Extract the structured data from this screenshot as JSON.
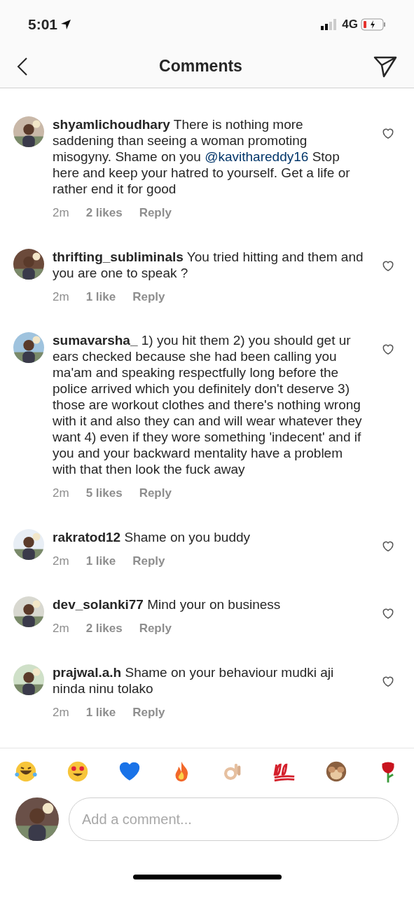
{
  "status_bar": {
    "time": "5:01",
    "network": "4G"
  },
  "header": {
    "title": "Comments"
  },
  "comments": [
    {
      "username": "shyamlichoudhary",
      "body": [
        {
          "kind": "text",
          "text": "There is nothing more saddening than seeing a woman promoting misogyny. Shame on you "
        },
        {
          "kind": "mention",
          "text": "@kavithareddy16"
        },
        {
          "kind": "text",
          "text": " Stop here and keep your hatred to yourself. Get a life or rather end it for good"
        }
      ],
      "time": "2m",
      "likes": "2 likes",
      "reply": "Reply",
      "liked": false
    },
    {
      "username": "thrifting_subliminals",
      "body": [
        {
          "kind": "text",
          "text": "You tried hitting and them and you are one to speak ?"
        }
      ],
      "time": "2m",
      "likes": "1 like",
      "reply": "Reply",
      "liked": false
    },
    {
      "username": "sumavarsha_",
      "body": [
        {
          "kind": "text",
          "text": "1) you hit them 2) you should get ur ears checked because she had been calling you ma'am and speaking respectfully long before the police arrived which you definitely don't deserve 3) those are workout clothes and there's nothing wrong with it and also they can and will wear whatever they want 4) even if they wore something 'indecent' and if you and your backward mentality have a problem with that then look the fuck away"
        }
      ],
      "time": "2m",
      "likes": "5 likes",
      "reply": "Reply",
      "liked": false
    },
    {
      "username": "rakratod12",
      "body": [
        {
          "kind": "text",
          "text": "Shame on you buddy"
        }
      ],
      "time": "2m",
      "likes": "1 like",
      "reply": "Reply",
      "liked": false
    },
    {
      "username": "dev_solanki77",
      "body": [
        {
          "kind": "text",
          "text": "Mind your on business"
        }
      ],
      "time": "2m",
      "likes": "2 likes",
      "reply": "Reply",
      "liked": false
    },
    {
      "username": "prajwal.a.h",
      "body": [
        {
          "kind": "text",
          "text": "Shame on your behaviour mudki aji ninda ninu tolako"
        }
      ],
      "time": "2m",
      "likes": "1 like",
      "reply": "Reply",
      "liked": false
    }
  ],
  "composer": {
    "placeholder": "Add a comment..."
  }
}
